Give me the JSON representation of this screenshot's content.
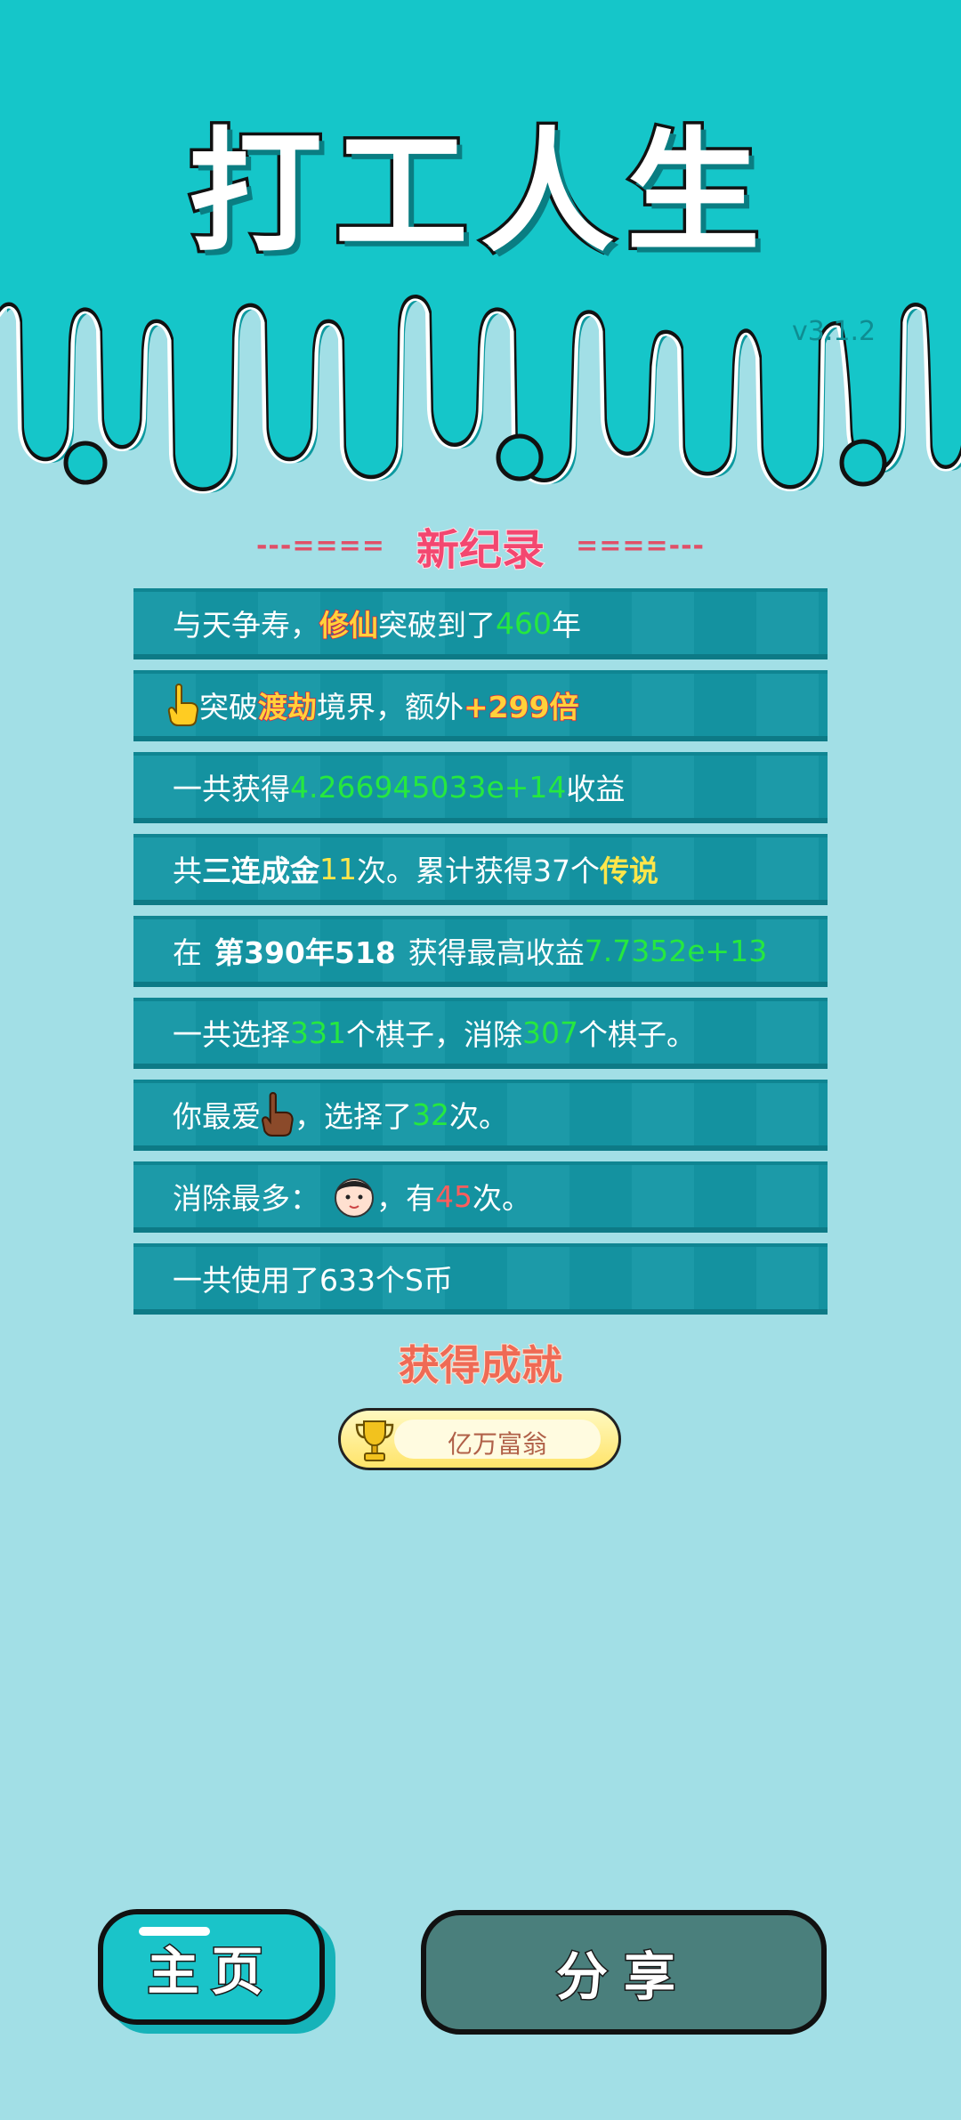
{
  "header": {
    "title": "打工人生",
    "version": "v3.1.2"
  },
  "record": {
    "dashes_left": "---====",
    "title": "新纪录",
    "dashes_right": "====---"
  },
  "rows": [
    {
      "a": "与天争寿，",
      "hl": "修仙",
      "b": "突破到了",
      "num": "460",
      "c": "年"
    },
    {
      "icon": "pointing-hand-yellow",
      "a": "突破",
      "hl": "渡劫",
      "b": "境界，额外",
      "hl2": "+299倍"
    },
    {
      "a": "一共获得",
      "num": "4.266945033e+14",
      "b": "收益"
    },
    {
      "a": "共",
      "bold": "三连成金",
      "num": "11",
      "b": "次。累计获得37个",
      "y": "传说"
    },
    {
      "a": "在",
      "bold": "第390年518",
      "b": "获得最高收益",
      "num": "7.7352e+13"
    },
    {
      "a": "一共选择",
      "num": "331",
      "b": "个棋子，消除",
      "num2": "307",
      "c": "个棋子。"
    },
    {
      "a": "你最爱",
      "icon": "pointing-hand-brown",
      "b": "，选择了",
      "num": "32",
      "c": "次。"
    },
    {
      "a": "消除最多：",
      "icon": "face-avatar",
      "b": "，有",
      "num": "45",
      "c": "次。"
    },
    {
      "a": "一共使用了633个S币"
    }
  ],
  "achievement": {
    "title": "获得成就",
    "badge": "亿万富翁",
    "icon": "trophy-icon"
  },
  "buttons": {
    "home": "主页",
    "share": "分享"
  },
  "colors": {
    "header_teal": "#15c6c9",
    "background": "#a2dfe6",
    "row": "#1597a5",
    "green_number": "#26e83f",
    "red_number": "#ff5d5d"
  }
}
